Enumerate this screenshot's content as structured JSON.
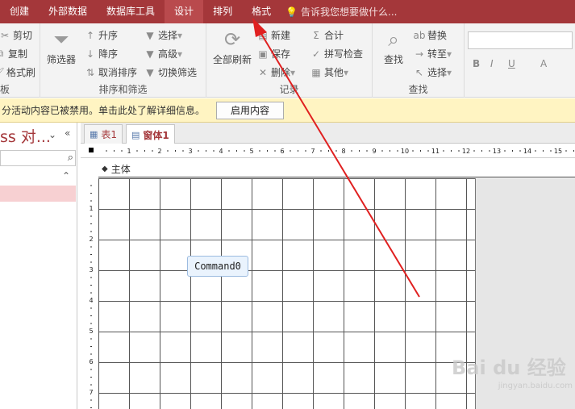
{
  "tabs": [
    "创建",
    "外部数据",
    "数据库工具",
    "设计",
    "排列",
    "格式"
  ],
  "tell_me": "告诉我您想要做什么...",
  "ribbon": {
    "clipboard": {
      "cut": "剪切",
      "copy": "复制",
      "format_painter": "格式刷",
      "label": "板"
    },
    "sort_filter": {
      "filter": "筛选器",
      "ascending": "升序",
      "descending": "降序",
      "clear_sort": "取消排序",
      "selection": "选择",
      "advanced": "高级",
      "toggle_filter": "切换筛选",
      "label": "排序和筛选"
    },
    "records": {
      "refresh_all": "全部刷新",
      "new": "新建",
      "save": "保存",
      "delete": "删除",
      "totals": "合计",
      "spelling": "拼写检查",
      "more": "其他",
      "label": "记录"
    },
    "find": {
      "find": "查找",
      "replace": "替换",
      "goto": "转至",
      "select": "选择",
      "label": "查找"
    },
    "text_format": {
      "bold": "B",
      "italic": "I",
      "underline": "U",
      "font_color": "A"
    }
  },
  "security_bar": {
    "message": "分活动内容已被禁用。单击此处了解详细信息。",
    "enable_button": "启用内容"
  },
  "nav_pane": {
    "title": "ss 对..."
  },
  "doc_tabs": [
    {
      "label": "表1"
    },
    {
      "label": "窗体1"
    }
  ],
  "designer": {
    "section_label": "主体",
    "ruler_numbers": [
      "1",
      "2",
      "3",
      "4",
      "5",
      "6",
      "7",
      "8",
      "9",
      "10",
      "11",
      "12",
      "13",
      "14",
      "15"
    ],
    "vruler_numbers": [
      "1",
      "2",
      "3",
      "4",
      "5",
      "6",
      "7"
    ],
    "command_button": "Command0"
  },
  "watermark": {
    "logo": "Bai du 经验",
    "url": "jingyan.baidu.com"
  }
}
